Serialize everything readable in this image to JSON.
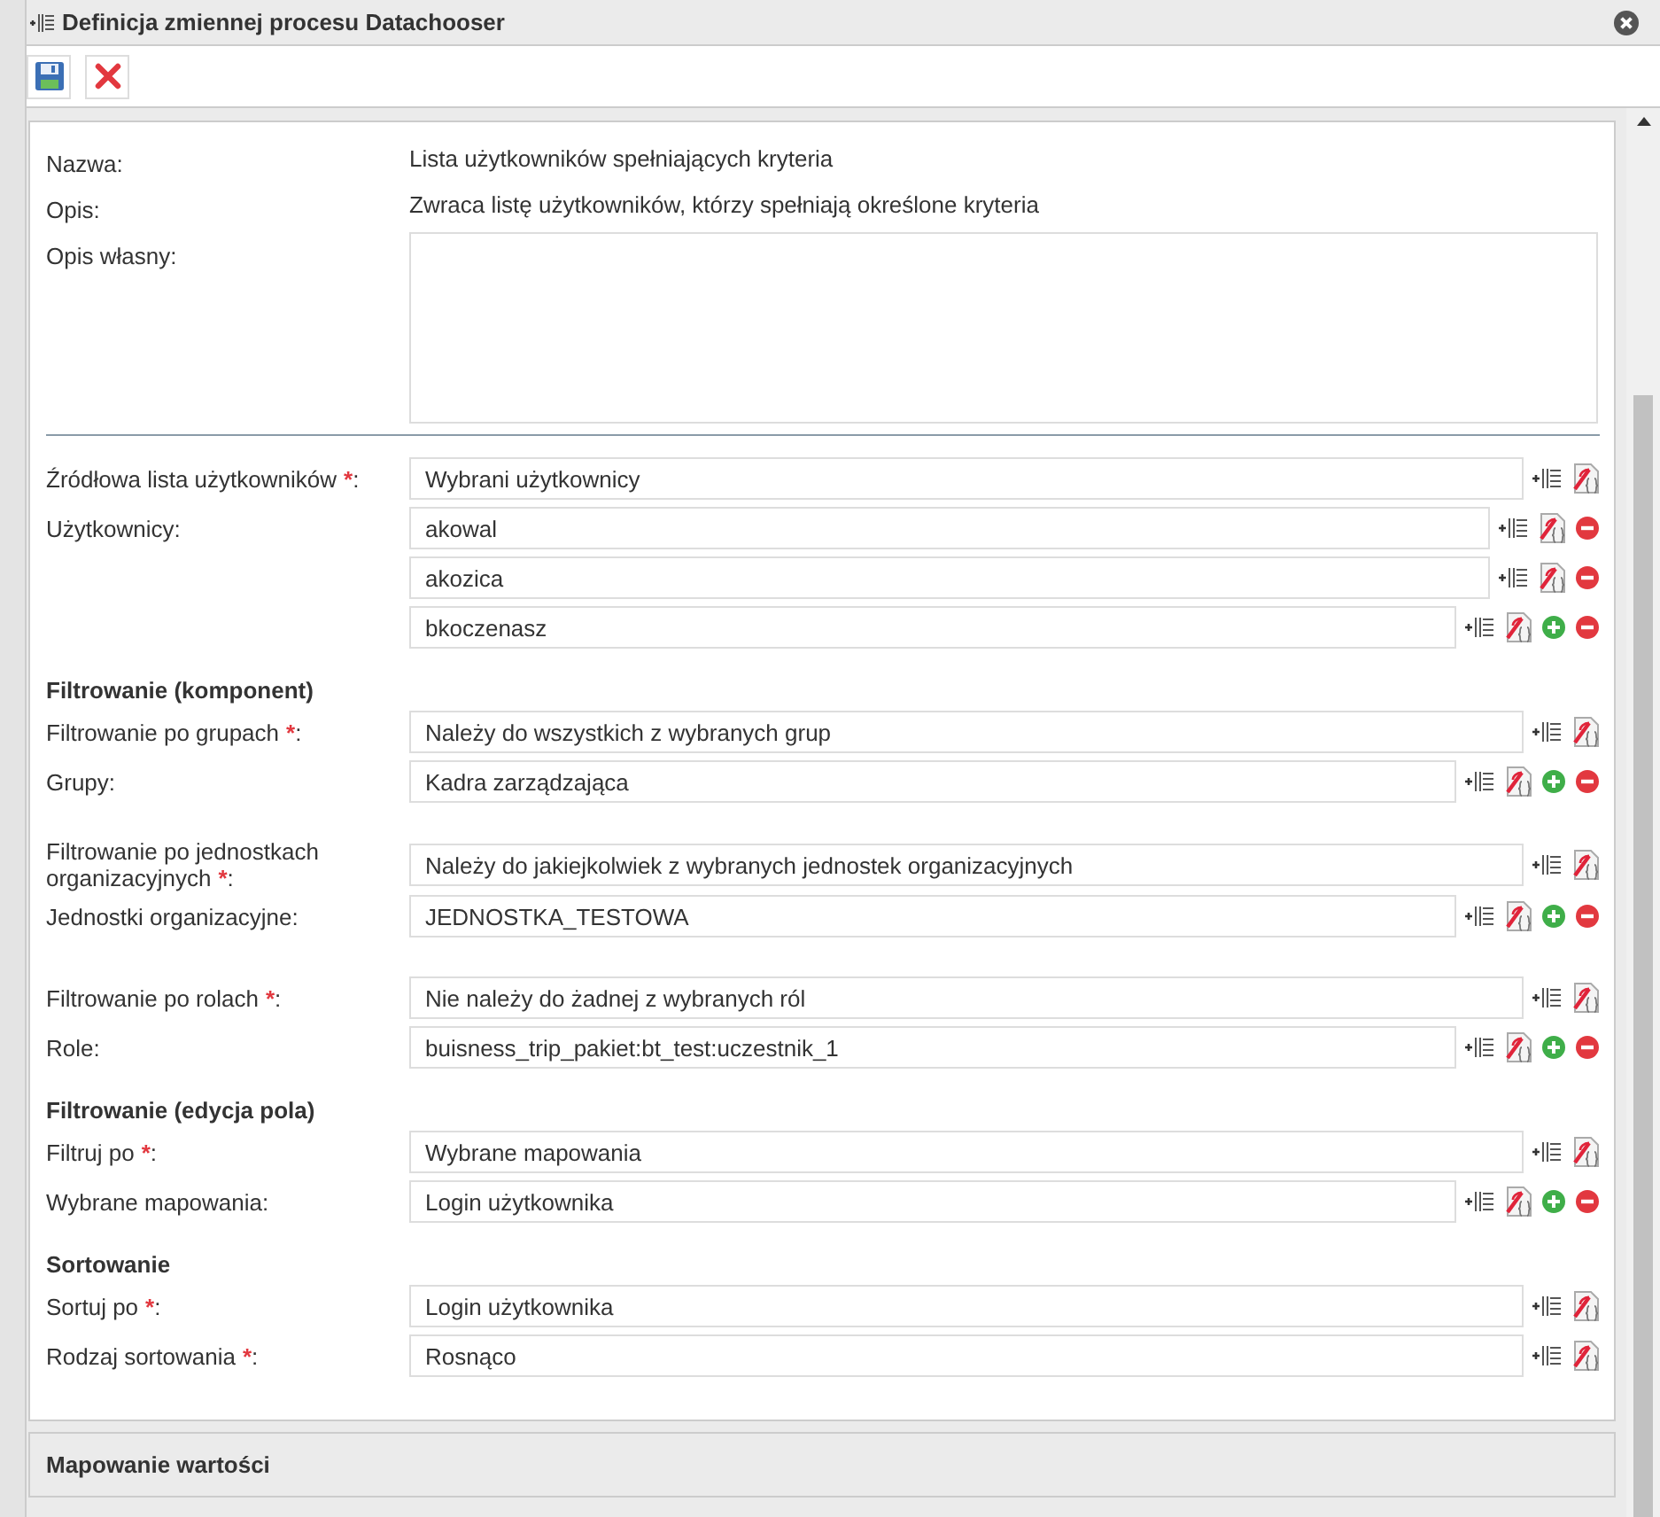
{
  "window": {
    "title": "Definicja zmiennej procesu Datachooser"
  },
  "toolbar": [
    {
      "kind": "save"
    },
    {
      "kind": "cancel"
    }
  ],
  "info": [
    {
      "label": "Nazwa:",
      "value": "Lista użytkowników spełniających kryteria"
    },
    {
      "label": "Opis:",
      "value": "Zwraca listę użytkowników, którzy spełniają określone kryteria"
    }
  ],
  "own_description": {
    "label": "Opis własny:"
  },
  "sections": [
    {
      "groups": [
        {
          "rows": [
            {
              "label": "Źródłowa lista użytkowników",
              "required_mark": "*",
              "label_end": ":",
              "value": "Wybrani użytkownicy",
              "can_add": false,
              "can_remove": false
            },
            {
              "label": "Użytkownicy:",
              "value": "akowal",
              "can_add": false,
              "can_remove": true
            },
            {
              "value": "akozica",
              "can_add": false,
              "can_remove": true
            },
            {
              "value": "bkoczenasz",
              "can_add": true,
              "can_remove": true
            }
          ]
        }
      ]
    },
    {
      "heading": "Filtrowanie (komponent)",
      "groups": [
        {
          "rows": [
            {
              "label": "Filtrowanie po grupach",
              "required_mark": "*",
              "label_end": ":",
              "value": "Należy do wszystkich z wybranych grup",
              "can_add": false,
              "can_remove": false
            },
            {
              "label": "Grupy:",
              "value": "Kadra zarządzająca",
              "can_add": true,
              "can_remove": true
            }
          ]
        },
        {
          "rows": [
            {
              "label": "Filtrowanie po jednostkach organizacyjnych",
              "required_mark": "*",
              "label_end": ":",
              "value": "Należy do jakiejkolwiek z wybranych jednostek organizacyjnych",
              "can_add": false,
              "can_remove": false
            },
            {
              "label": "Jednostki organizacyjne:",
              "value": "JEDNOSTKA_TESTOWA",
              "can_add": true,
              "can_remove": true
            }
          ]
        },
        {
          "rows": [
            {
              "label": "Filtrowanie po rolach",
              "required_mark": "*",
              "label_end": ":",
              "value": "Nie należy do żadnej z wybranych ról",
              "can_add": false,
              "can_remove": false
            },
            {
              "label": "Role:",
              "value": "buisness_trip_pakiet:bt_test:uczestnik_1",
              "can_add": true,
              "can_remove": true
            }
          ]
        }
      ]
    },
    {
      "heading": "Filtrowanie (edycja pola)",
      "groups": [
        {
          "rows": [
            {
              "label": "Filtruj po",
              "required_mark": "*",
              "label_end": ":",
              "value": "Wybrane mapowania",
              "can_add": false,
              "can_remove": false
            },
            {
              "label": "Wybrane mapowania:",
              "value": "Login użytkownika",
              "can_add": true,
              "can_remove": true
            }
          ]
        }
      ]
    },
    {
      "heading": "Sortowanie",
      "groups": [
        {
          "rows": [
            {
              "label": "Sortuj po",
              "required_mark": "*",
              "label_end": ":",
              "value": "Login użytkownika",
              "can_add": false,
              "can_remove": false
            },
            {
              "label": "Rodzaj sortowania",
              "required_mark": "*",
              "label_end": ":",
              "value": "Rosnąco",
              "can_add": false,
              "can_remove": false
            }
          ]
        }
      ]
    }
  ],
  "collapsed_panel": {
    "title": "Mapowanie wartości"
  }
}
